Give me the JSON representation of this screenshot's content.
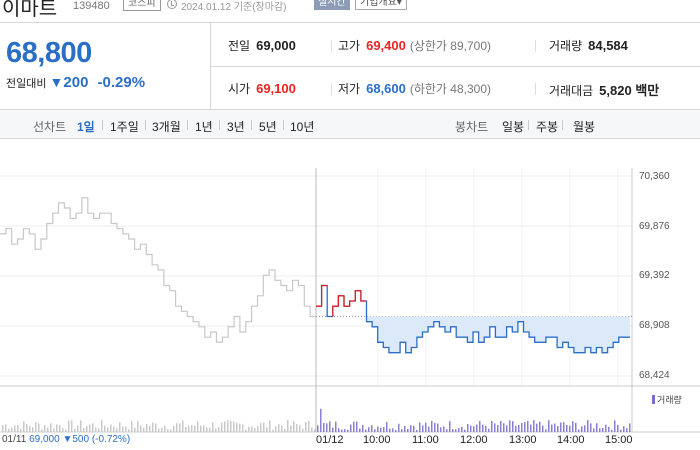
{
  "header": {
    "stock_name": "이마트",
    "stock_code": "139480",
    "market": "코스피",
    "date": "2024.01.12 기준(장마감)",
    "realtime": "실시간",
    "company_info": "기업개요▾"
  },
  "price": {
    "current": "68,800",
    "change_label": "전일대비",
    "change_arrow": "▼",
    "change_amount": "200",
    "change_percent": "-0.29%"
  },
  "quotes": {
    "prev_close": {
      "label": "전일",
      "value": "69,000"
    },
    "high": {
      "label": "고가",
      "value": "69,400",
      "sub": "(상한가 89,700)"
    },
    "volume": {
      "label": "거래량",
      "value": "84,584"
    },
    "open": {
      "label": "시가",
      "value": "69,100"
    },
    "low": {
      "label": "저가",
      "value": "68,600",
      "sub": "(하한가 48,300)"
    },
    "trade_value": {
      "label": "거래대금",
      "value": "5,820 백만"
    }
  },
  "toolbar": {
    "line_chart_label": "선차트",
    "line_tabs": [
      "1일",
      "1주일",
      "3개월",
      "1년",
      "3년",
      "5년",
      "10년"
    ],
    "active_tab": "1일",
    "candle_chart_label": "봉차트",
    "candle_tabs": [
      "일봉",
      "주봉",
      "월봉"
    ]
  },
  "chart": {
    "y_ticks": [
      "70,360",
      "69,876",
      "69,392",
      "68,908",
      "68,424"
    ],
    "volume_label": "거래량",
    "x_ticks": [
      "01/12",
      "10:00",
      "11:00",
      "12:00",
      "13:00",
      "14:00",
      "15:00"
    ],
    "prev_day_date": "01/11",
    "prev_day_price": "69,000",
    "prev_day_change": "▼500 (-0.72%)"
  },
  "colors": {
    "accent_blue": "#2a6ec7",
    "up_red": "#e22222",
    "fill_blue": "#dce9f8",
    "prev_gray": "#c8c8c8"
  },
  "chart_data": {
    "type": "line",
    "y_unit": "KRW",
    "ylim": [
      68424,
      70360
    ],
    "x_ticks": [
      "01/12",
      "10:00",
      "11:00",
      "12:00",
      "13:00",
      "14:00",
      "15:00"
    ],
    "series": [
      {
        "name": "01/11",
        "values": [
          69800,
          69850,
          69700,
          69750,
          69850,
          69800,
          69650,
          69750,
          69900,
          70000,
          70100,
          70050,
          69950,
          70000,
          70150,
          70000,
          69950,
          70000,
          70000,
          69900,
          69850,
          69800,
          69750,
          69650,
          69700,
          69600,
          69500,
          69450,
          69300,
          69250,
          69100,
          69050,
          69000,
          68950,
          68900,
          68800,
          68850,
          68750,
          68800,
          68900,
          69000,
          68850,
          68950,
          69100,
          69200,
          69400,
          69450,
          69350,
          69300,
          69250,
          69350,
          69300,
          69100,
          69000
        ]
      },
      {
        "name": "01/12",
        "values": [
          69100,
          69300,
          69000,
          69100,
          69200,
          69100,
          69150,
          69250,
          69150,
          68950,
          68900,
          68750,
          68700,
          68650,
          68650,
          68750,
          68650,
          68700,
          68800,
          68850,
          68900,
          68950,
          68900,
          68850,
          68900,
          68800,
          68800,
          68750,
          68850,
          68750,
          68800,
          68900,
          68800,
          68800,
          68900,
          68850,
          68950,
          68850,
          68800,
          68750,
          68750,
          68800,
          68800,
          68700,
          68750,
          68700,
          68650,
          68650,
          68700,
          68650,
          68700,
          68650,
          68700,
          68750,
          68800,
          68800
        ]
      }
    ],
    "baseline": 69000
  }
}
